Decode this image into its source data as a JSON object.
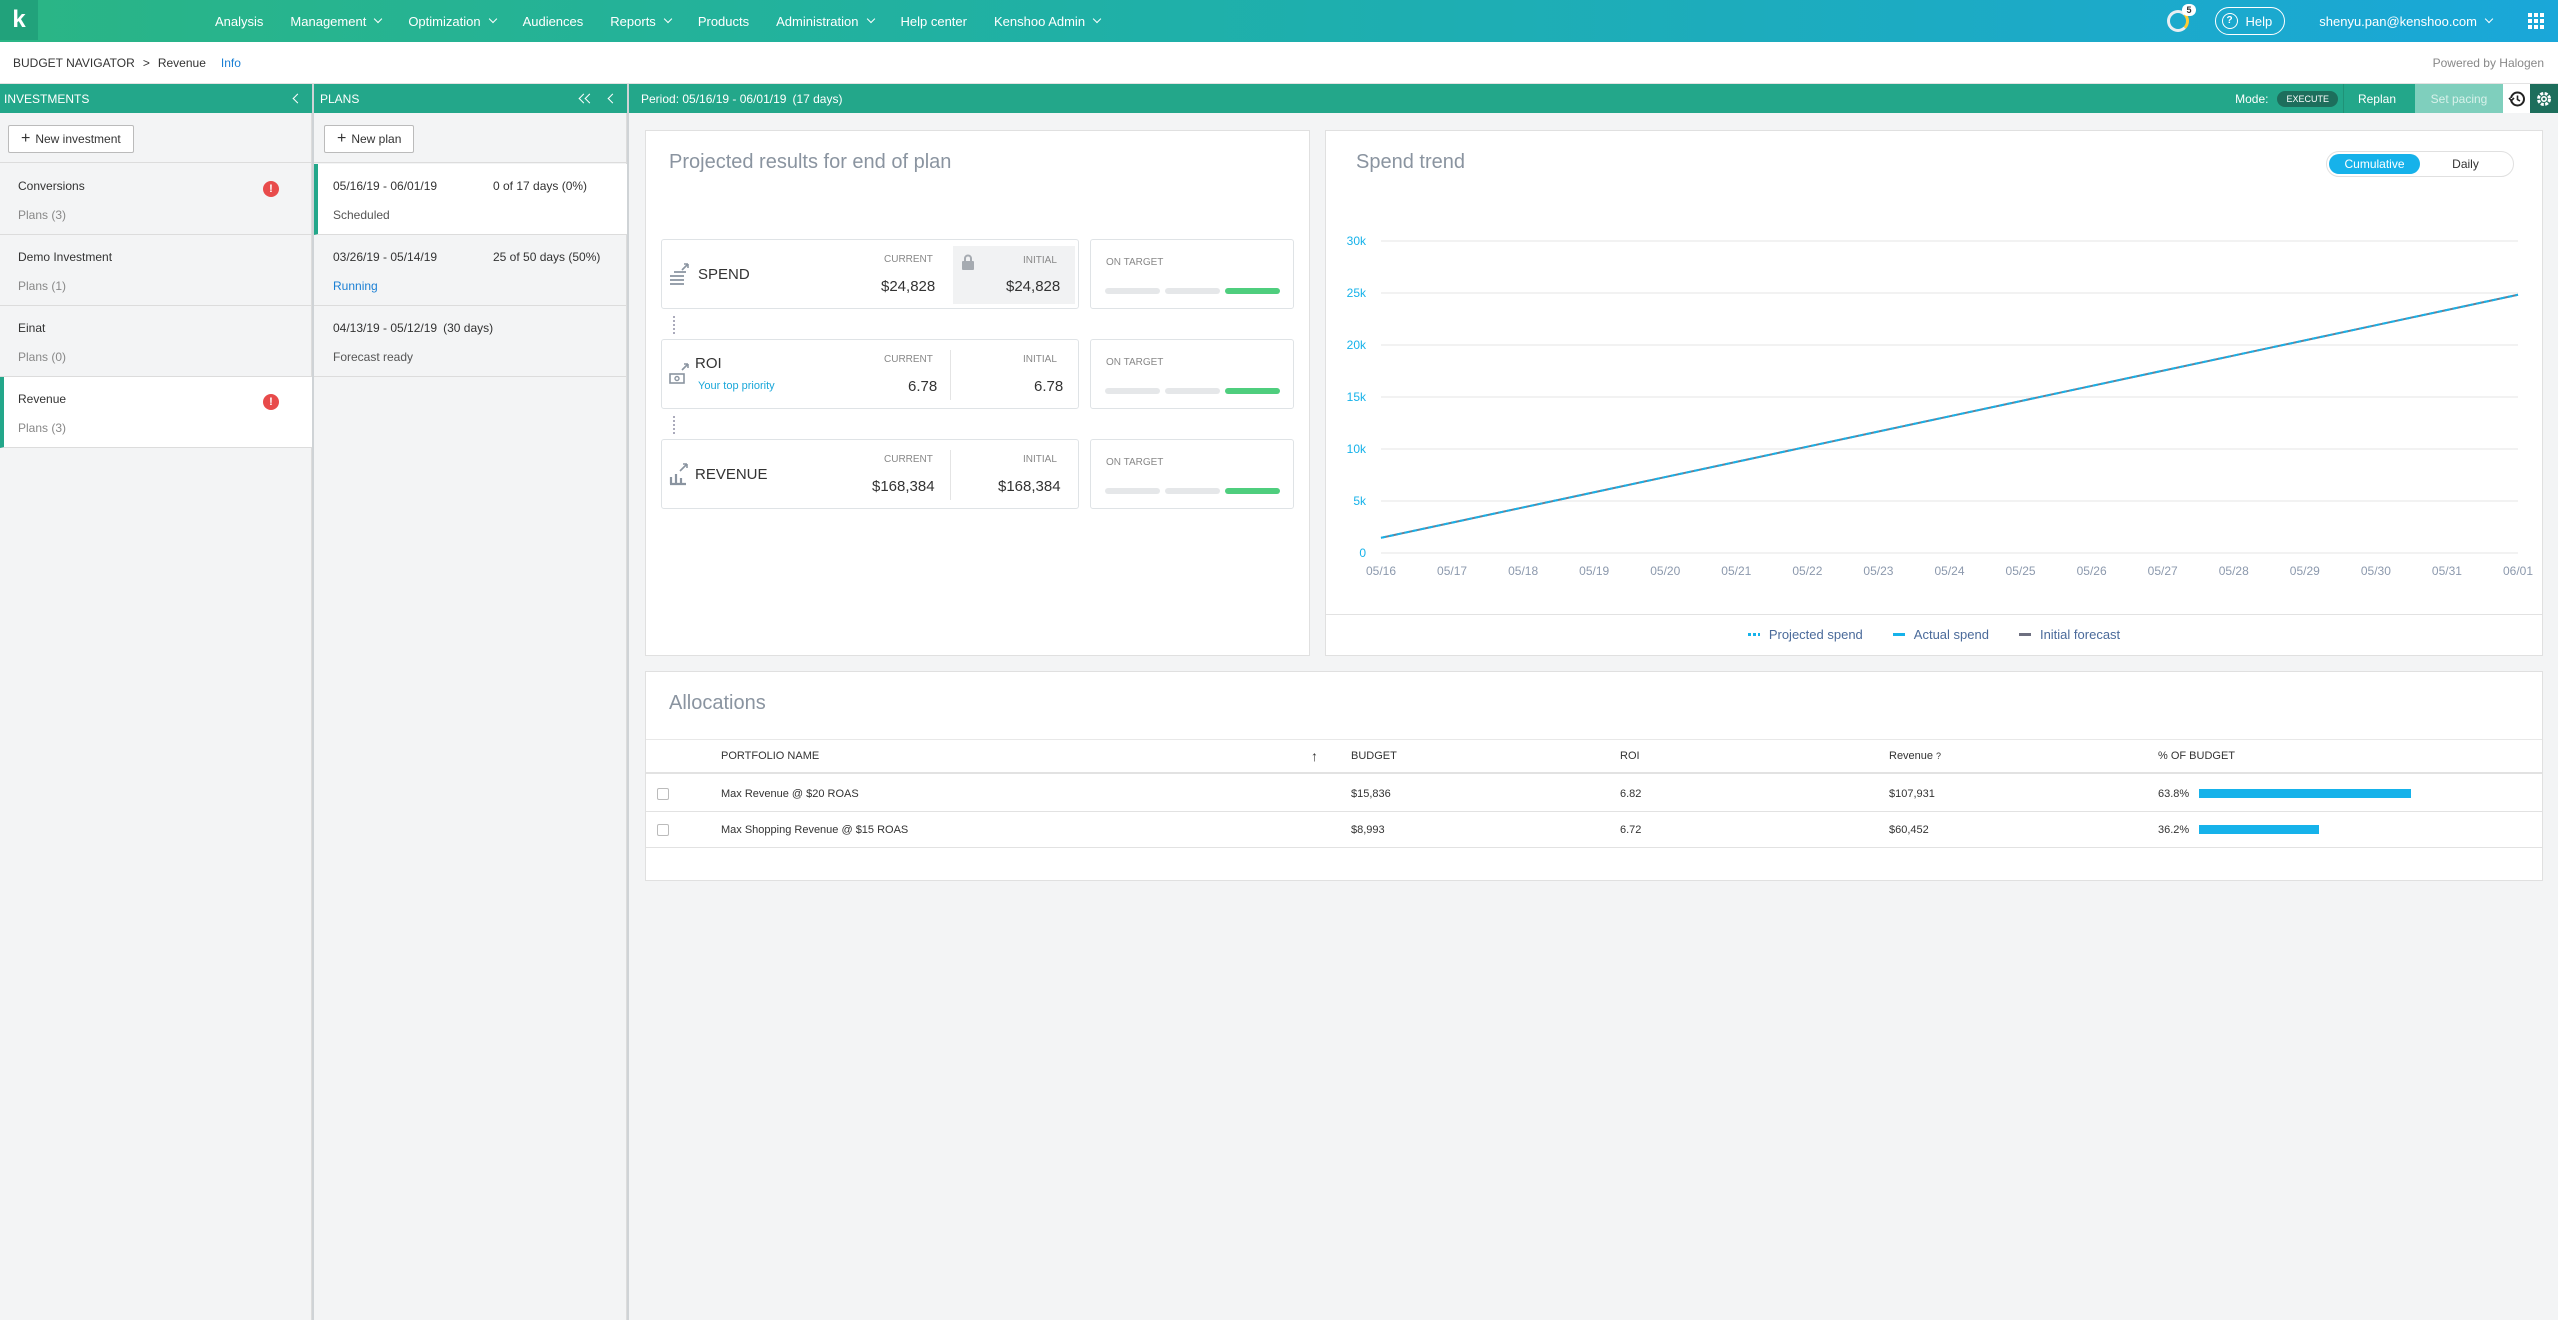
{
  "topnav": {
    "logo": "k",
    "items": [
      "Analysis",
      "Management",
      "Optimization",
      "Audiences",
      "Reports",
      "Products",
      "Administration",
      "Help center",
      "Kenshoo Admin"
    ],
    "notifications": "5",
    "help": "Help",
    "user": "shenyu.pan@kenshoo.com"
  },
  "subheader": {
    "breadcrumb_root": "BUDGET NAVIGATOR",
    "breadcrumb_sep": ">",
    "breadcrumb_current": "Revenue",
    "info_link": "Info",
    "powered_by": "Powered by Halogen"
  },
  "investments": {
    "header": "INVESTMENTS",
    "new_button": "New investment",
    "items": [
      {
        "name": "Conversions",
        "plans": "Plans (3)",
        "alert": true
      },
      {
        "name": "Demo Investment",
        "plans": "Plans (1)",
        "alert": false
      },
      {
        "name": "Einat",
        "plans": "Plans (0)",
        "alert": false
      },
      {
        "name": "Revenue",
        "plans": "Plans (3)",
        "alert": true
      }
    ]
  },
  "plans": {
    "header": "PLANS",
    "new_button": "New plan",
    "items": [
      {
        "dates": "05/16/19 - 06/01/19",
        "progress": "0 of 17 days (0%)",
        "status": "Scheduled"
      },
      {
        "dates": "03/26/19 - 05/14/19",
        "progress": "25 of 50 days (50%)",
        "status": "Running"
      },
      {
        "dates": "04/13/19 - 05/12/19",
        "progress": "(30 days)",
        "status": "Forecast ready"
      }
    ]
  },
  "period_bar": {
    "period": "Period: 05/16/19 - 06/01/19",
    "days": "(17 days)",
    "mode_label": "Mode:",
    "mode_value": "EXECUTE",
    "replan": "Replan",
    "set_pacing": "Set pacing"
  },
  "projected": {
    "title": "Projected results for end of plan",
    "current_label": "CURRENT",
    "initial_label": "INITIAL",
    "on_target": "ON TARGET",
    "metrics": [
      {
        "name": "SPEND",
        "sub": "",
        "current": "$24,828",
        "initial": "$24,828",
        "locked": true
      },
      {
        "name": "ROI",
        "sub": "Your top priority",
        "current": "6.78",
        "initial": "6.78",
        "locked": false
      },
      {
        "name": "REVENUE",
        "sub": "",
        "current": "$168,384",
        "initial": "$168,384",
        "locked": false
      }
    ]
  },
  "spend_trend": {
    "title": "Spend trend",
    "toggle": [
      "Cumulative",
      "Daily"
    ],
    "legend": [
      "Projected spend",
      "Actual spend",
      "Initial forecast"
    ]
  },
  "colors": {
    "accent": "#23a78a",
    "chart_line": "#3a9bc8",
    "bar": "#16b2ea"
  },
  "chart_data": {
    "type": "line",
    "title": "Spend trend",
    "x": [
      "05/16",
      "05/17",
      "05/18",
      "05/19",
      "05/20",
      "05/21",
      "05/22",
      "05/23",
      "05/24",
      "05/25",
      "05/26",
      "05/27",
      "05/28",
      "05/29",
      "05/30",
      "05/31",
      "06/01"
    ],
    "yticks": [
      "0",
      "5k",
      "10k",
      "15k",
      "20k",
      "25k",
      "30k"
    ],
    "ylim": [
      0,
      30000
    ],
    "series": [
      {
        "name": "Projected spend",
        "values": [
          1460,
          2921,
          4381,
          5842,
          7302,
          8763,
          10223,
          11684,
          13144,
          14605,
          16065,
          17526,
          18986,
          20447,
          21907,
          23368,
          24828
        ]
      },
      {
        "name": "Initial forecast",
        "values": [
          1460,
          2921,
          4381,
          5842,
          7302,
          8763,
          10223,
          11684,
          13144,
          14605,
          16065,
          17526,
          18986,
          20447,
          21907,
          23368,
          24828
        ]
      }
    ],
    "grid": true,
    "legend_position": "bottom"
  },
  "allocations": {
    "title": "Allocations",
    "columns": [
      "PORTFOLIO NAME",
      "BUDGET",
      "ROI",
      "Revenue",
      "% OF BUDGET"
    ],
    "rows": [
      {
        "name": "Max Revenue @ $20 ROAS",
        "budget": "$15,836",
        "roi": "6.82",
        "revenue": "$107,931",
        "pct": "63.8%",
        "pct_value": 63.8
      },
      {
        "name": "Max Shopping Revenue @ $15 ROAS",
        "budget": "$8,993",
        "roi": "6.72",
        "revenue": "$60,452",
        "pct": "36.2%",
        "pct_value": 36.2
      }
    ]
  }
}
